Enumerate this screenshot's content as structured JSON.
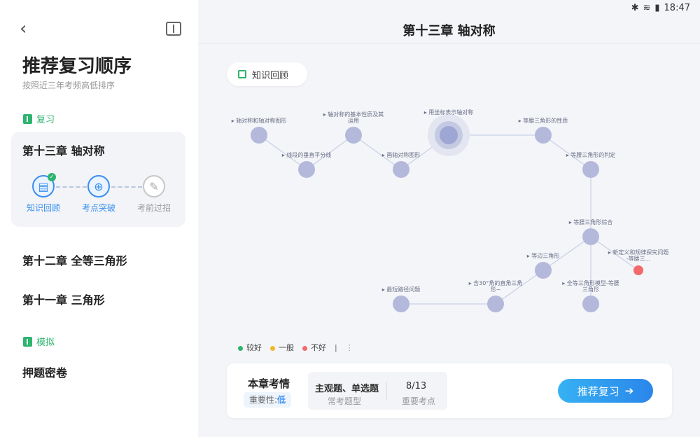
{
  "status_bar": {
    "time": "18:47",
    "icons": [
      "gallery-icon",
      "notification-icon",
      "bluetooth-icon",
      "wifi-icon",
      "battery-icon"
    ]
  },
  "sidebar": {
    "title": "推荐复习顺序",
    "subtitle": "按照近三年考频高低排序",
    "review_section": "复习",
    "current_chapter": {
      "title": "第十三章 轴对称",
      "steps": [
        {
          "label": "知识回顾",
          "icon": "book-icon",
          "completed": true
        },
        {
          "label": "考点突破",
          "icon": "target-icon"
        },
        {
          "label": "考前过招",
          "icon": "pencil-icon"
        }
      ]
    },
    "chapters": [
      "第十二章 全等三角形",
      "第十一章 三角形"
    ],
    "simulation_section": "模拟",
    "simulation_item": "押题密卷"
  },
  "main": {
    "title": "第十三章 轴对称",
    "review_pill": "知识回顾",
    "knowledge_nodes": [
      {
        "label": "轴对称和轴对称图形"
      },
      {
        "label": "线段的垂直平分线"
      },
      {
        "label": "轴对称的基本性质及其运用"
      },
      {
        "label": "画轴对称图形"
      },
      {
        "label": "用坐标表示轴对称"
      },
      {
        "label": "等腰三角形的性质"
      },
      {
        "label": "等腰三角形的判定"
      },
      {
        "label": "等腰三角形综合"
      },
      {
        "label": "新定义和规律探究问题-等腰三..."
      },
      {
        "label": "等边三角形"
      },
      {
        "label": "全等三角形模型-等腰三角形"
      },
      {
        "label": "含30°角的直角三角形~"
      },
      {
        "label": "最短路径问题"
      }
    ],
    "legend": [
      {
        "label": "较好",
        "color": "#2db46e"
      },
      {
        "label": "一般",
        "color": "#f5b62e"
      },
      {
        "label": "不好",
        "color": "#f26a6a"
      }
    ],
    "exam_info": {
      "title": "本章考情",
      "importance_label": "重要性:",
      "importance_value": "低",
      "question_types": "主观题、单选题",
      "question_types_label": "常考题型",
      "key_points": "8/13",
      "key_points_label": "重要考点",
      "cta": "推荐复习"
    }
  }
}
